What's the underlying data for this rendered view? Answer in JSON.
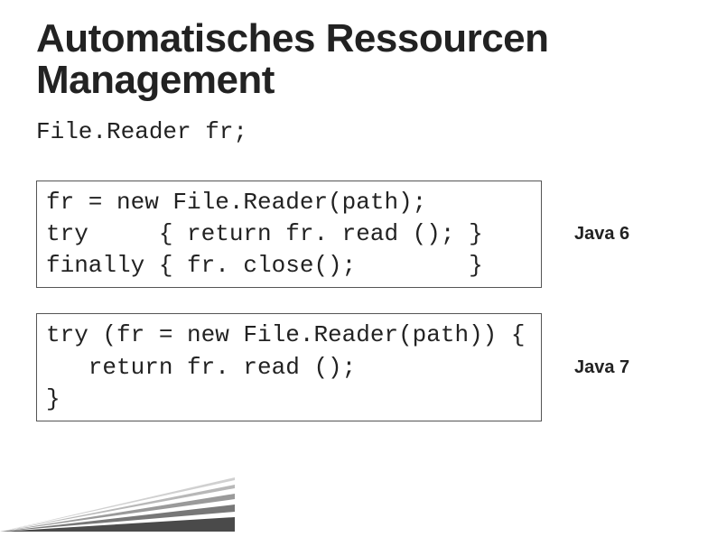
{
  "title": "Automatisches Ressourcen Management",
  "declaration": "File.Reader fr;",
  "block1": {
    "code": "fr = new File.Reader(path);\ntry     { return fr. read (); }\nfinally { fr. close();        }",
    "label": "Java 6"
  },
  "block2": {
    "code": "try (fr = new File.Reader(path)) {\n   return fr. read ();\n}",
    "label": "Java 7"
  }
}
